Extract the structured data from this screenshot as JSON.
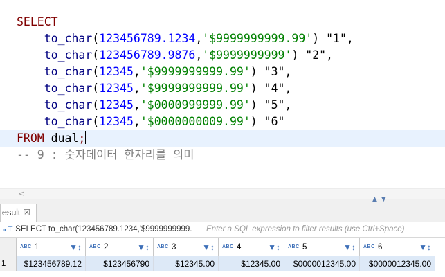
{
  "editor": {
    "lines": [
      {
        "parts": [
          {
            "c": "kw",
            "t": "SELECT"
          }
        ]
      },
      {
        "parts": [
          {
            "c": "",
            "t": "    "
          },
          {
            "c": "fn",
            "t": "to_char"
          },
          {
            "c": "",
            "t": "("
          },
          {
            "c": "num",
            "t": "123456789.1234"
          },
          {
            "c": "",
            "t": ","
          },
          {
            "c": "str",
            "t": "'$9999999999.99'"
          },
          {
            "c": "",
            "t": ") \"1\","
          }
        ]
      },
      {
        "parts": [
          {
            "c": "",
            "t": "    "
          },
          {
            "c": "fn",
            "t": "to_char"
          },
          {
            "c": "",
            "t": "("
          },
          {
            "c": "num",
            "t": "123456789.9876"
          },
          {
            "c": "",
            "t": ","
          },
          {
            "c": "str",
            "t": "'$9999999999'"
          },
          {
            "c": "",
            "t": ") \"2\","
          }
        ]
      },
      {
        "parts": [
          {
            "c": "",
            "t": "    "
          },
          {
            "c": "fn",
            "t": "to_char"
          },
          {
            "c": "",
            "t": "("
          },
          {
            "c": "num",
            "t": "12345"
          },
          {
            "c": "",
            "t": ","
          },
          {
            "c": "str",
            "t": "'$9999999999.99'"
          },
          {
            "c": "",
            "t": ") \"3\","
          }
        ]
      },
      {
        "parts": [
          {
            "c": "",
            "t": "    "
          },
          {
            "c": "fn",
            "t": "to_char"
          },
          {
            "c": "",
            "t": "("
          },
          {
            "c": "num",
            "t": "12345"
          },
          {
            "c": "",
            "t": ","
          },
          {
            "c": "str",
            "t": "'$9999999999.99'"
          },
          {
            "c": "",
            "t": ") \"4\","
          }
        ]
      },
      {
        "parts": [
          {
            "c": "",
            "t": "    "
          },
          {
            "c": "fn",
            "t": "to_char"
          },
          {
            "c": "",
            "t": "("
          },
          {
            "c": "num",
            "t": "12345"
          },
          {
            "c": "",
            "t": ","
          },
          {
            "c": "str",
            "t": "'$0000999999.99'"
          },
          {
            "c": "",
            "t": ") \"5\","
          }
        ]
      },
      {
        "parts": [
          {
            "c": "",
            "t": "    "
          },
          {
            "c": "fn",
            "t": "to_char"
          },
          {
            "c": "",
            "t": "("
          },
          {
            "c": "num",
            "t": "12345"
          },
          {
            "c": "",
            "t": ","
          },
          {
            "c": "str",
            "t": "'$0000000009.99'"
          },
          {
            "c": "",
            "t": ") \"6\""
          }
        ]
      },
      {
        "parts": [
          {
            "c": "kw",
            "t": "FROM"
          },
          {
            "c": "",
            "t": " dual"
          },
          {
            "c": "kw",
            "t": ";"
          }
        ],
        "caret": true
      },
      {
        "parts": [
          {
            "c": "cmt",
            "t": "-- 9 : 숫자데이터 한자리를 의미"
          }
        ]
      }
    ]
  },
  "scrollbar": {
    "left_arrow": "<"
  },
  "results_tab": {
    "label": "esult",
    "close": "☒"
  },
  "filter": {
    "sql_text": "SELECT to_char(123456789.1234,'$9999999999.",
    "placeholder": "Enter a SQL expression to filter results (use Ctrl+Space)"
  },
  "grid": {
    "type_badge": "ABC",
    "columns": [
      "1",
      "2",
      "3",
      "4",
      "5",
      "6"
    ],
    "rows": [
      {
        "num": "1",
        "cells": [
          "$123456789.12",
          "$123456790",
          "$12345.00",
          "$12345.00",
          "$0000012345.00",
          "$0000012345.00"
        ]
      }
    ]
  },
  "colors": {
    "keyword": "#800000",
    "function": "#000080",
    "number": "#0000ff",
    "string": "#008000",
    "comment": "#808080",
    "selection": "#dde9f7"
  }
}
